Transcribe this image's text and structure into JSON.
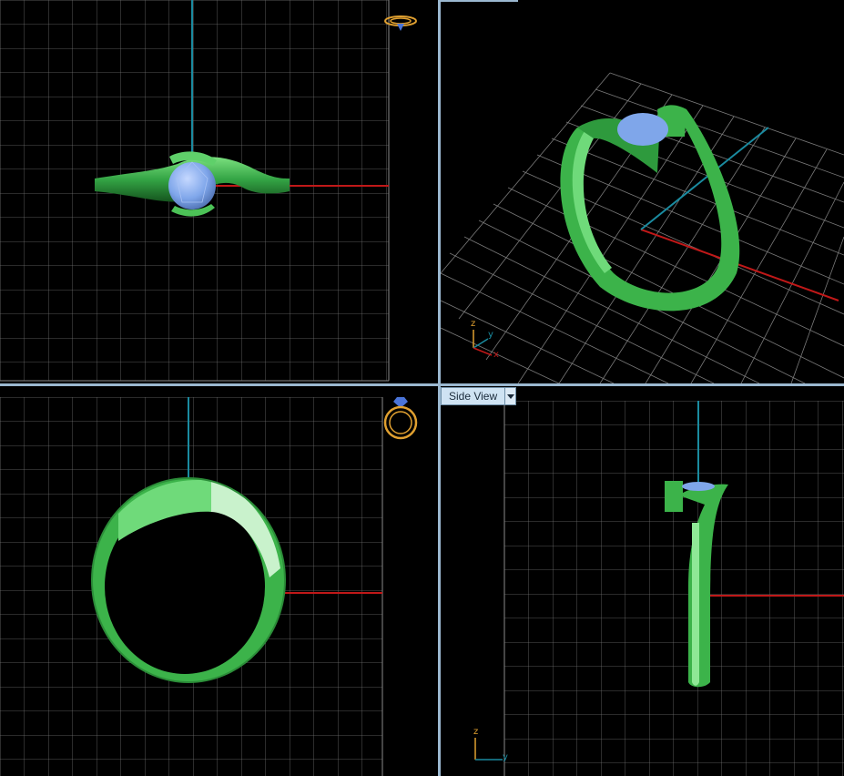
{
  "viewports": {
    "top": {
      "name": "top-viewport"
    },
    "perspective": {
      "name": "perspective-viewport",
      "axis_labels": {
        "z": "z",
        "y": "y",
        "x": "x"
      }
    },
    "front": {
      "name": "front-viewport"
    },
    "side": {
      "name": "side-viewport",
      "view_label": "Side View",
      "axis_labels": {
        "z": "z",
        "y": "y"
      }
    }
  },
  "colors": {
    "background": "#000000",
    "grid": "#8a8a8a",
    "grid_major": "#b0b0b0",
    "axis_x": "#c01818",
    "axis_y": "#1a8ba0",
    "ring_band": "#3cb34a",
    "gem": "#7fa6ea",
    "separator": "#9bb8d0",
    "gizmo": "#e0a030"
  },
  "icons": {
    "ring_gizmo_top": "ring-gizmo-icon",
    "ring_gizmo_front": "ring-gizmo-icon"
  }
}
